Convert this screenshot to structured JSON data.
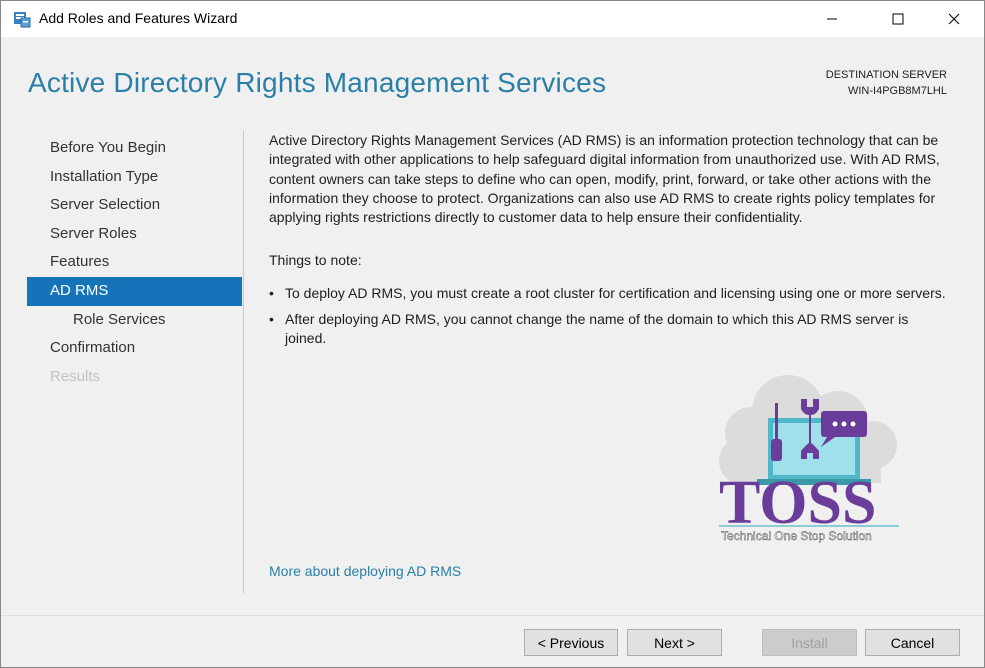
{
  "window": {
    "title": "Add Roles and Features Wizard"
  },
  "header": {
    "page_title": "Active Directory Rights Management Services",
    "destination_label": "DESTINATION SERVER",
    "destination_server": "WIN-I4PGB8M7LHL"
  },
  "nav": {
    "items": [
      {
        "label": "Before You Begin",
        "state": "normal"
      },
      {
        "label": "Installation Type",
        "state": "normal"
      },
      {
        "label": "Server Selection",
        "state": "normal"
      },
      {
        "label": "Server Roles",
        "state": "normal"
      },
      {
        "label": "Features",
        "state": "normal"
      },
      {
        "label": "AD RMS",
        "state": "active"
      },
      {
        "label": "Role Services",
        "state": "sub"
      },
      {
        "label": "Confirmation",
        "state": "normal"
      },
      {
        "label": "Results",
        "state": "disabled"
      }
    ]
  },
  "content": {
    "description": "Active Directory Rights Management Services (AD RMS) is an information protection technology that can be integrated with other applications to help safeguard digital information from unauthorized use. With AD RMS, content owners can take steps to define who can open, modify, print, forward, or take other actions with the information they choose to protect. Organizations can also use AD RMS to create rights policy templates for applying rights restrictions directly to customer data to help ensure their confidentiality.",
    "notes_heading": "Things to note:",
    "bullet_symbol": "•",
    "notes": [
      "To deploy AD RMS, you must create a root cluster for certification and licensing using one or more servers.",
      "After deploying AD RMS, you cannot change the name of the domain to which this AD RMS server is joined."
    ],
    "more_link": "More about deploying AD RMS"
  },
  "logo": {
    "wordmark": "TOSS",
    "tagline": "Technical One Stop Solution"
  },
  "footer": {
    "previous_label": "< Previous",
    "next_label": "Next >",
    "install_label": "Install",
    "cancel_label": "Cancel"
  },
  "colors": {
    "accent": "#1573ba",
    "title_blue": "#2a7fa8",
    "logo_purple": "#6a3d9a",
    "logo_teal": "#2aa8b8",
    "cloud_gray": "#d9d9d9"
  }
}
